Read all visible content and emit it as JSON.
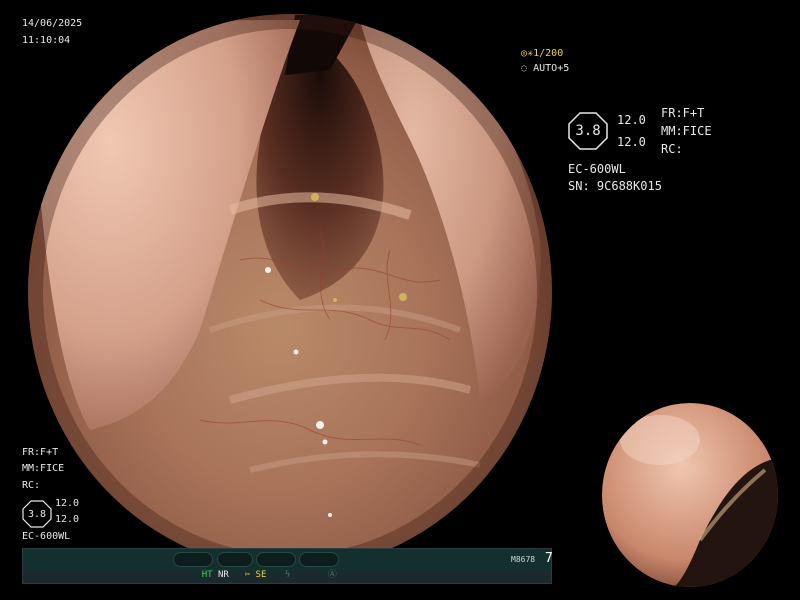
{
  "header": {
    "date": "14/06/2025",
    "time": "11:10:04",
    "zoom_readout": "1/200",
    "auto_readout": "AUTO+5"
  },
  "right_panel": {
    "fr": "FR:F+T",
    "mm": "MM:FICE",
    "rc": "RC:",
    "enhancement": "3.8",
    "value_1": "12.0",
    "value_2": "12.0",
    "model": "EC-600WL",
    "serial": "SN: 9C688K015"
  },
  "left_panel": {
    "fr": "FR:F+T",
    "mm": "MM:FICE",
    "rc": "RC:",
    "enhancement": "3.8",
    "value_1": "12.0",
    "value_2": "12.0",
    "model": "EC-600WL"
  },
  "status_bar": {
    "ht": "HT",
    "nr": "NR",
    "se": "SE",
    "code": "M8678",
    "count": "7"
  },
  "icons": [
    "camera-icon",
    "light-icon",
    "scissors-icon",
    "flash-icon",
    "target-icon"
  ],
  "colors": {
    "overlay_text": "#e8e8e8",
    "accent_yellow": "#e9d24a",
    "accent_green": "#37d25a",
    "status_bar": "#1b2a2d"
  }
}
